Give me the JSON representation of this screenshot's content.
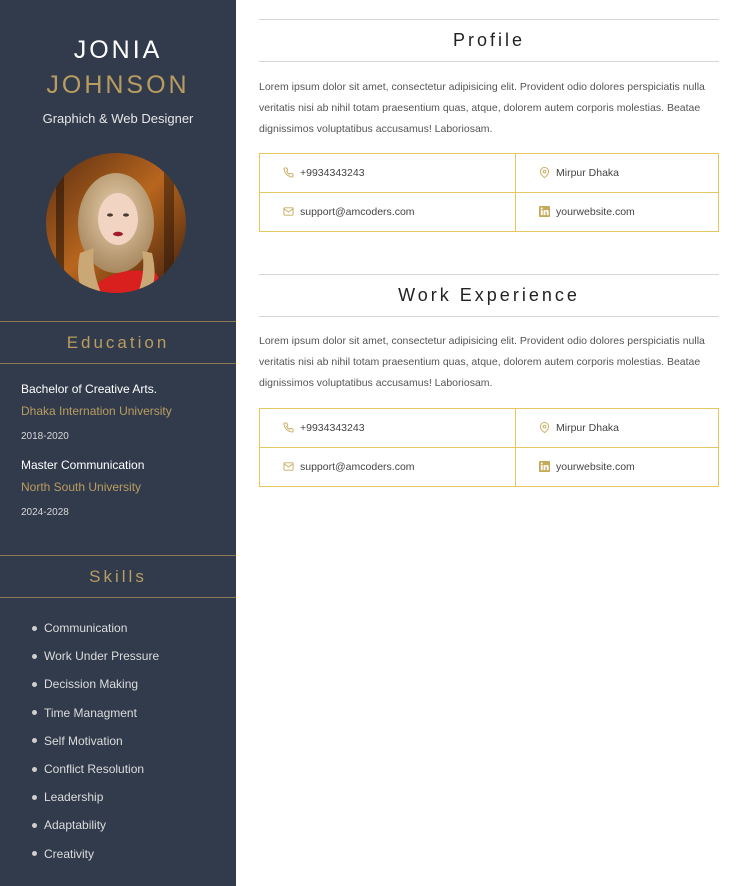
{
  "sidebar": {
    "first_name": "JONIA",
    "last_name": "JOHNSON",
    "job_title": "Graphich & Web Designer",
    "education_title": "Education",
    "education": [
      {
        "degree": "Bachelor of Creative Arts.",
        "school": "Dhaka Internation University",
        "years": "2018-2020"
      },
      {
        "degree": "Master Communication",
        "school": "North South University",
        "years": "2024-2028"
      }
    ],
    "skills_title": "Skills",
    "skills": [
      "Communication",
      "Work Under Pressure",
      "Decission Making",
      "Time Managment",
      "Self Motivation",
      "Conflict Resolution",
      "Leadership",
      "Adaptability",
      "Creativity"
    ]
  },
  "profile": {
    "title": "Profile",
    "text": "Lorem ipsum dolor sit amet, consectetur adipisicing elit. Provident odio dolores perspiciatis nulla veritatis nisi ab nihil totam praesentium quas, atque, dolorem autem corporis molestias. Beatae dignissimos voluptatibus accusamus! Laboriosam.",
    "contacts": {
      "phone": "+9934343243",
      "location": "Mirpur Dhaka",
      "email": "support@amcoders.com",
      "website": "yourwebsite.com"
    }
  },
  "work": {
    "title": "Work Experience",
    "text": "Lorem ipsum dolor sit amet, consectetur adipisicing elit. Provident odio dolores perspiciatis nulla veritatis nisi ab nihil totam praesentium quas, atque, dolorem autem corporis molestias. Beatae dignissimos voluptatibus accusamus! Laboriosam.",
    "contacts": {
      "phone": "+9934343243",
      "location": "Mirpur Dhaka",
      "email": "support@amcoders.com",
      "website": "yourwebsite.com"
    }
  },
  "colors": {
    "sidebar_bg": "#323b4c",
    "accent_gold": "#b99d60",
    "grid_border": "#e6c75d"
  },
  "icons": {
    "phone": "phone-icon",
    "location": "map-pin-icon",
    "email": "envelope-icon",
    "website": "linkedin-icon"
  }
}
